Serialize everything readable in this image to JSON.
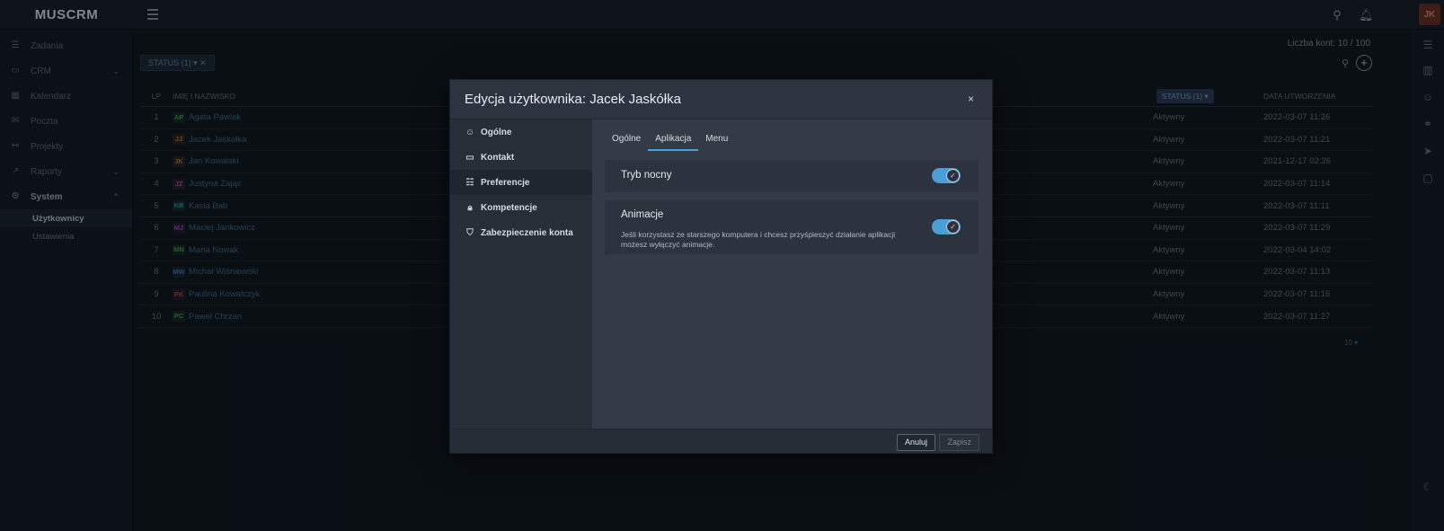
{
  "app": {
    "logo": "MUSCRM",
    "user_initials": "JK"
  },
  "sidebar": {
    "items": [
      {
        "label": "Zadania",
        "icon": "tasks-icon"
      },
      {
        "label": "CRM",
        "icon": "crm-icon"
      },
      {
        "label": "Kalendarz",
        "icon": "calendar-icon"
      },
      {
        "label": "Poczta",
        "icon": "mail-icon"
      },
      {
        "label": "Projekty",
        "icon": "projects-icon"
      },
      {
        "label": "Raporty",
        "icon": "reports-icon"
      },
      {
        "label": "System",
        "icon": "settings-icon"
      }
    ],
    "sub_items": [
      {
        "label": "Użytkownicy"
      },
      {
        "label": "Ustawienia"
      }
    ]
  },
  "content": {
    "account_count": "Liczba kont: 10 / 100",
    "filter_chip": "STATUS (1) ▾ ✕",
    "headers": {
      "lp": "LP",
      "name": "IMIĘ I NAZWISKO",
      "status": "STATUS (1) ▾",
      "date": "DATA UTWORZENIA"
    },
    "rows": [
      {
        "lp": "1",
        "initials": "AP",
        "color": "#3fa35a",
        "name": "Agata Pawlak",
        "status": "Aktywny",
        "date": "2022-03-07 11:26"
      },
      {
        "lp": "2",
        "initials": "JJ",
        "color": "#d07a2c",
        "name": "Jacek Jaskółka",
        "status": "Aktywny",
        "date": "2022-03-07 11:21"
      },
      {
        "lp": "3",
        "initials": "JK",
        "color": "#d07a2c",
        "name": "Jan Kowalski",
        "status": "Aktywny",
        "date": "2021-12-17 02:26"
      },
      {
        "lp": "4",
        "initials": "JZ",
        "color": "#c04a9a",
        "name": "Justyna Zając",
        "status": "Aktywny",
        "date": "2022-03-07 11:14"
      },
      {
        "lp": "5",
        "initials": "KB",
        "color": "#2aa3a3",
        "name": "Kasia Bab",
        "status": "Aktywny",
        "date": "2022-03-07 11:11"
      },
      {
        "lp": "6",
        "initials": "MJ",
        "color": "#a04ac0",
        "name": "Maciej Jankowicz",
        "status": "Aktywny",
        "date": "2022-03-07 11:29"
      },
      {
        "lp": "7",
        "initials": "MN",
        "color": "#3fa35a",
        "name": "Maria Nowak",
        "status": "Aktywny",
        "date": "2022-03-04 14:02"
      },
      {
        "lp": "8",
        "initials": "MW",
        "color": "#3b7fc0",
        "name": "Michał Wiśniewski",
        "status": "Aktywny",
        "date": "2022-03-07 11:13"
      },
      {
        "lp": "9",
        "initials": "PK",
        "color": "#c0404a",
        "name": "Paulina Kowalczyk",
        "status": "Aktywny",
        "date": "2022-03-07 11:16"
      },
      {
        "lp": "10",
        "initials": "PC",
        "color": "#3fa35a",
        "name": "Paweł Chrzan",
        "status": "Aktywny",
        "date": "2022-03-07 11:27"
      }
    ],
    "page_size": "10 ▾"
  },
  "modal": {
    "title": "Edycja użytkownika: Jacek Jaskółka",
    "close": "×",
    "nav": [
      {
        "label": "Ogólne",
        "icon": "user-card-icon"
      },
      {
        "label": "Kontakt",
        "icon": "contact-card-icon"
      },
      {
        "label": "Preferencje",
        "icon": "sliders-icon"
      },
      {
        "label": "Kompetencje",
        "icon": "lock-icon"
      },
      {
        "label": "Zabezpieczenie konta",
        "icon": "shield-icon"
      }
    ],
    "tabs": [
      "Ogólne",
      "Aplikacja",
      "Menu"
    ],
    "settings": [
      {
        "title": "Tryb nocny",
        "description": "",
        "enabled": true
      },
      {
        "title": "Animacje",
        "description": "Jeśli korzystasz ze starszego komputera i chcesz przyśpieszyć działanie aplikacji możesz wyłączyć animacje.",
        "enabled": true
      }
    ],
    "buttons": {
      "cancel": "Anuluj",
      "save": "Zapisz"
    }
  }
}
